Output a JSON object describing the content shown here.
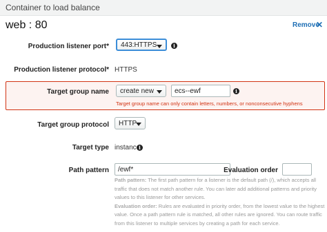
{
  "header": {
    "title": "Container to load balance"
  },
  "section": {
    "title": "web : 80",
    "remove_label": "Remove",
    "remove_icon": "close-icon",
    "remove_symbol": "✕"
  },
  "fields": {
    "listener_port": {
      "label": "Production listener port*",
      "value": "443:HTTPS"
    },
    "listener_protocol": {
      "label": "Production listener protocol*",
      "value": "HTTPS"
    },
    "target_group_name": {
      "label": "Target group name",
      "select_value": "create new",
      "input_value": "ecs--ewf",
      "error": "Target group name can only contain letters, numbers, or nonconsecutive hyphens"
    },
    "target_group_protocol": {
      "label": "Target group protocol",
      "value": "HTTP"
    },
    "target_type": {
      "label": "Target type",
      "value": "instance"
    },
    "path_pattern": {
      "label": "Path pattern",
      "value": "/ewf*"
    },
    "evaluation_order": {
      "label": "Evaluation order",
      "value": ""
    }
  },
  "help": {
    "path_pattern_title": "Path pattern:",
    "path_pattern_text": "The first path pattern for a listener is the default path (/), which accepts all traffic that does not match another rule. You can later add additional patterns and priority values to this listener for other services.",
    "evaluation_order_title": "Evaluation order:",
    "evaluation_order_text": "Rules are evaluated in priority order, from the lowest value to the highest value. Once a path pattern rule is matched, all other rules are ignored. You can route traffic from this listener to multiple services by creating a path for each service."
  },
  "colors": {
    "error": "#d13212",
    "link": "#1e6fb5",
    "focus": "#3b8dd8"
  }
}
